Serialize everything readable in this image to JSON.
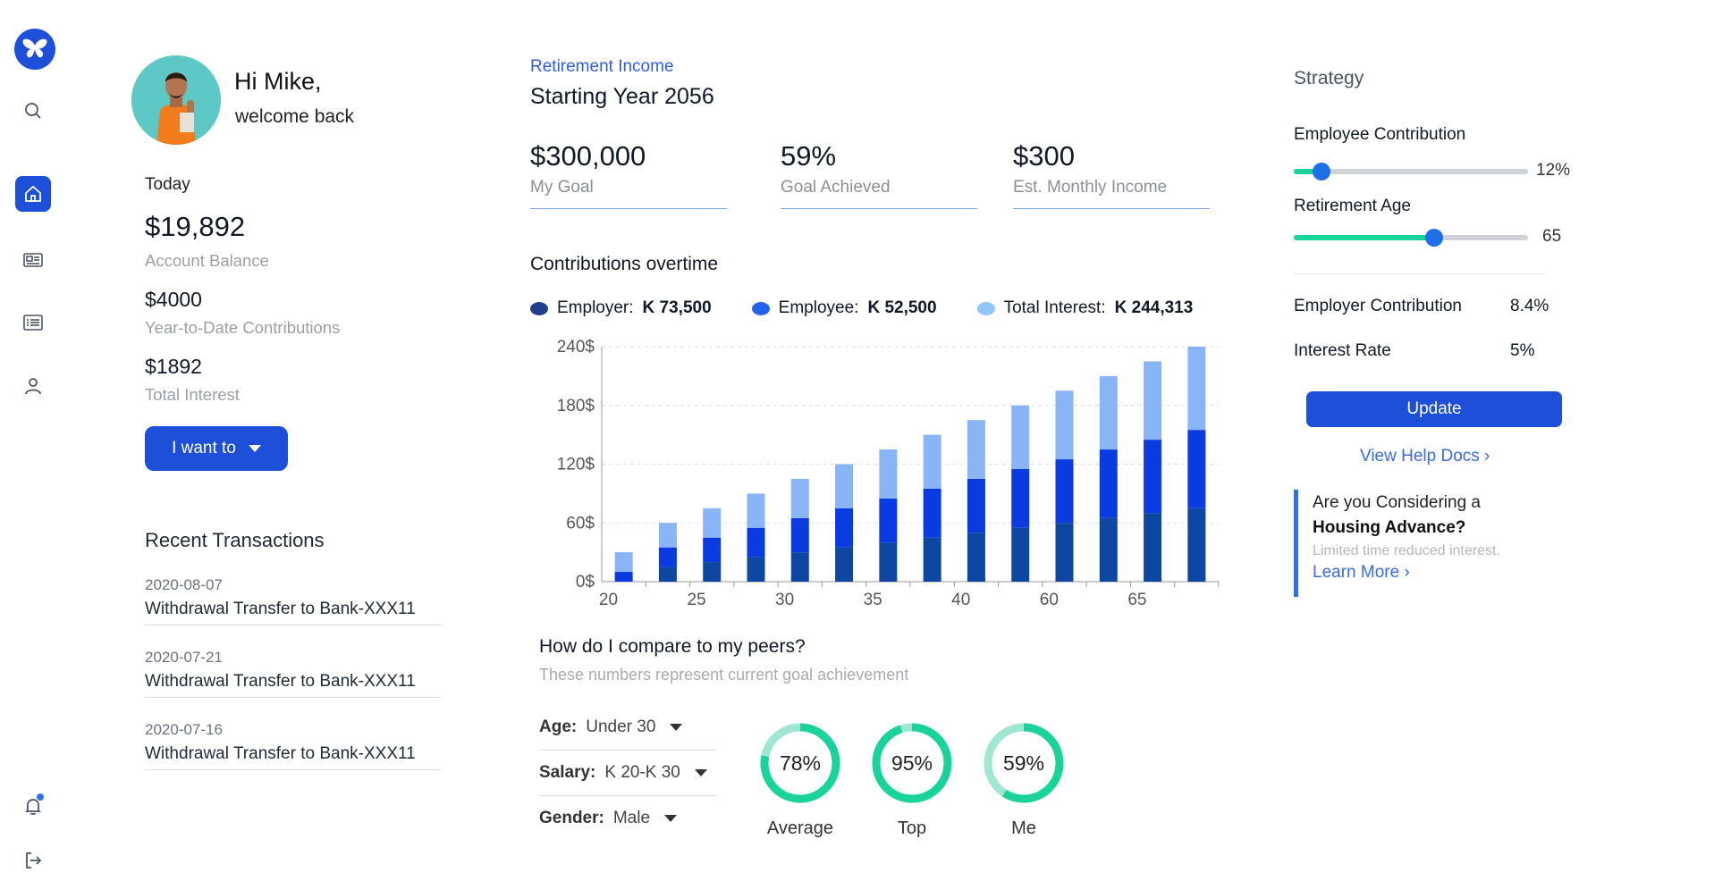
{
  "colors": {
    "primary": "#1e4fd8",
    "employer": "#0d47a1",
    "employee": "#0a3be0",
    "interest": "#89b4f5",
    "teal": "#19d39a",
    "teal_light": "#9fe6d3"
  },
  "sidebar": {
    "items": [
      {
        "name": "search",
        "icon": "search-icon"
      },
      {
        "name": "home",
        "icon": "home-icon",
        "active": true
      },
      {
        "name": "news",
        "icon": "newspaper-icon"
      },
      {
        "name": "list",
        "icon": "list-icon"
      },
      {
        "name": "profile",
        "icon": "user-icon"
      },
      {
        "name": "notifications",
        "icon": "bell-icon"
      },
      {
        "name": "logout",
        "icon": "logout-icon"
      }
    ]
  },
  "profile": {
    "greeting": "Hi Mike,",
    "welcome": "welcome back"
  },
  "summary": {
    "today_label": "Today",
    "account_balance": "$19,892",
    "account_balance_label": "Account Balance",
    "ytd": "$4000",
    "ytd_label": "Year-to-Date Contributions",
    "interest": "$1892",
    "interest_label": "Total Interest",
    "action_label": "I want to"
  },
  "transactions": {
    "title": "Recent Transactions",
    "items": [
      {
        "date": "2020-08-07",
        "desc": "Withdrawal Transfer to Bank-XXX11"
      },
      {
        "date": "2020-07-21",
        "desc": "Withdrawal Transfer to Bank-XXX11"
      },
      {
        "date": "2020-07-16",
        "desc": "Withdrawal Transfer to Bank-XXX11"
      }
    ]
  },
  "retirement": {
    "label": "Retirement Income",
    "year": "Starting Year 2056",
    "kpis": [
      {
        "value": "$300,000",
        "label": "My Goal"
      },
      {
        "value": "59%",
        "label": "Goal Achieved"
      },
      {
        "value": "$300",
        "label": "Est. Monthly Income"
      }
    ]
  },
  "contributions": {
    "title": "Contributions overtime",
    "legend": [
      {
        "label": "Employer:",
        "value": "K 73,500"
      },
      {
        "label": "Employee:",
        "value": "K 52,500"
      },
      {
        "label": "Total Interest:",
        "value": "K 244,313"
      }
    ]
  },
  "chart_data": {
    "type": "bar",
    "stacked": true,
    "x_tick_labels": [
      "20",
      "25",
      "30",
      "35",
      "40",
      "60",
      "65"
    ],
    "y_tick_labels": [
      "0$",
      "60$",
      "120$",
      "180$",
      "240$"
    ],
    "ylim": [
      0,
      240
    ],
    "grid": true,
    "series": [
      {
        "name": "Employer",
        "values": [
          0,
          15,
          20,
          25,
          30,
          35,
          40,
          45,
          50,
          55,
          60,
          65,
          70,
          75
        ]
      },
      {
        "name": "Employee",
        "values": [
          10,
          20,
          25,
          30,
          35,
          40,
          45,
          50,
          55,
          60,
          65,
          70,
          75,
          80
        ]
      },
      {
        "name": "Total Interest",
        "values": [
          20,
          25,
          30,
          35,
          40,
          45,
          50,
          55,
          60,
          65,
          70,
          75,
          80,
          85
        ]
      }
    ]
  },
  "peers": {
    "title": "How do I compare to my peers?",
    "subtitle": "These numbers represent current goal achievement",
    "filters": [
      {
        "key": "Age:",
        "value": "Under 30"
      },
      {
        "key": "Salary:",
        "value": "K 20-K 30"
      },
      {
        "key": "Gender:",
        "value": "Male"
      }
    ],
    "donuts": [
      {
        "pct": "78%",
        "value": 78,
        "label": "Average"
      },
      {
        "pct": "95%",
        "value": 95,
        "label": "Top"
      },
      {
        "pct": "59%",
        "value": 59,
        "label": "Me"
      }
    ]
  },
  "strategy": {
    "title": "Strategy",
    "employee_contribution_label": "Employee Contribution",
    "employee_contribution_value": "12%",
    "employee_contribution_level": 0.12,
    "retirement_age_label": "Retirement Age",
    "retirement_age_value": "65",
    "retirement_age_level": 0.6,
    "employer_contribution_label": "Employer Contribution",
    "employer_contribution_value": "8.4%",
    "interest_rate_label": "Interest Rate",
    "interest_rate_value": "5%",
    "update_label": "Update",
    "help_label": "View Help Docs ›",
    "promo_line1": "Are you Considering a",
    "promo_line2": "Housing Advance?",
    "promo_line3": "Limited time reduced interest.",
    "promo_link": "Learn More ›"
  }
}
